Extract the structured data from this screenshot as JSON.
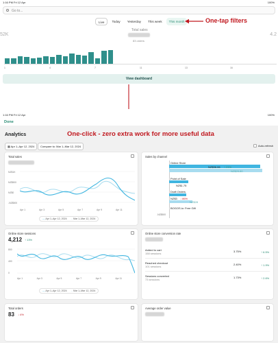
{
  "top": {
    "status_time": "1:16 PM   Fri 12 Apr",
    "status_right": "100%",
    "search_placeholder": "Go to...",
    "filters": [
      "Live",
      "Today",
      "Yesterday",
      "This week",
      "This month"
    ],
    "active_filter": "This month",
    "total_sales_label": "Total sales",
    "orders_text": "83 orders",
    "left_value": "52K",
    "right_value": "4.2",
    "bars": [
      0.3,
      0.28,
      0.42,
      0.36,
      0.28,
      0.32,
      0.4,
      0.36,
      0.48,
      0.42,
      0.55,
      0.48,
      0.45,
      0.62,
      0.3,
      0.7,
      0.74
    ],
    "x_ticks": [
      "1",
      "4",
      "7",
      "11",
      "13",
      "16"
    ],
    "view_dashboard": "View dashboard",
    "annotation": "One-tap filters"
  },
  "bottom": {
    "status_time": "1:16 PM   Fri 12 Apr",
    "status_right": "100%",
    "done": "Done",
    "title": "Analytics",
    "annotation": "One-click - zero extra work for more useful data",
    "date_range": "Apr 1–Apr 12, 2024",
    "compare": "Compare to: Mar 1–Mar 12, 2024",
    "auto_refresh": "Auto-refresh",
    "total_sales": {
      "title": "Total sales",
      "y_ticks": [
        "NZ$1K",
        "NZ$500",
        "NZ$0",
        "-NZ$500"
      ],
      "x_ticks": [
        "Apr 1",
        "Apr 3",
        "Apr 5",
        "Apr 7",
        "Apr 9",
        "Apr 11"
      ],
      "legend_current": "Apr 1–Apr 12, 2024",
      "legend_compare": "Mar 1–Mar 12, 2024"
    },
    "sales_by_channel": {
      "title": "Sales by channel",
      "channels": [
        {
          "name": "Online Store",
          "value": "NZ$36.06",
          "change": "↑ 21%",
          "compare": "NZ$29.80",
          "current_frac": 0.95,
          "compare_frac": 0.97
        },
        {
          "name": "Point of Sale",
          "value": "NZ$1.75",
          "change": "",
          "compare": "",
          "current_frac": 0.2,
          "compare_frac": 0.0
        },
        {
          "name": "Draft Orders",
          "value": "NZ$3",
          "change": "↓ 86%",
          "compare": "NZ$28",
          "current_frac": 0.18,
          "compare_frac": 0.24
        },
        {
          "name": "BOGOS.io: Free Gift",
          "value": "",
          "change": "",
          "compare": "",
          "current_frac": 0.0,
          "compare_frac": 0.0
        }
      ],
      "axis_value": "-NZ$500"
    },
    "sessions": {
      "title": "Online store sessions",
      "value": "4,212",
      "change": "↑ 13%",
      "y_ticks": [
        "800",
        "400",
        "0"
      ],
      "x_ticks": [
        "Apr 1",
        "Apr 3",
        "Apr 5",
        "Apr 7",
        "Apr 9",
        "Apr 11"
      ],
      "legend_current": "Apr 1–Apr 12, 2024",
      "legend_compare": "Mar 1–Mar 12, 2024"
    },
    "conversion": {
      "title": "Online store conversion rate",
      "rows": [
        {
          "label": "Added to cart",
          "sub": "158 sessions",
          "pct": "3.75%",
          "change": "↑ 6.5%"
        },
        {
          "label": "Reached checkout",
          "sub": "101 sessions",
          "pct": "2.40%",
          "change": "↑ 1.9%"
        },
        {
          "label": "Sessions converted",
          "sub": "73 sessions",
          "pct": "1.73%",
          "change": "↑ 2.6%"
        }
      ]
    },
    "total_orders": {
      "title": "Total orders",
      "value": "83",
      "change": "↓ 4%"
    },
    "avg_order": {
      "title": "Average order value"
    }
  },
  "colors": {
    "accent": "#2f8f8b",
    "annotation": "#c0181f",
    "chart_current": "#3fb5e0",
    "chart_compare": "#a8dcef"
  }
}
